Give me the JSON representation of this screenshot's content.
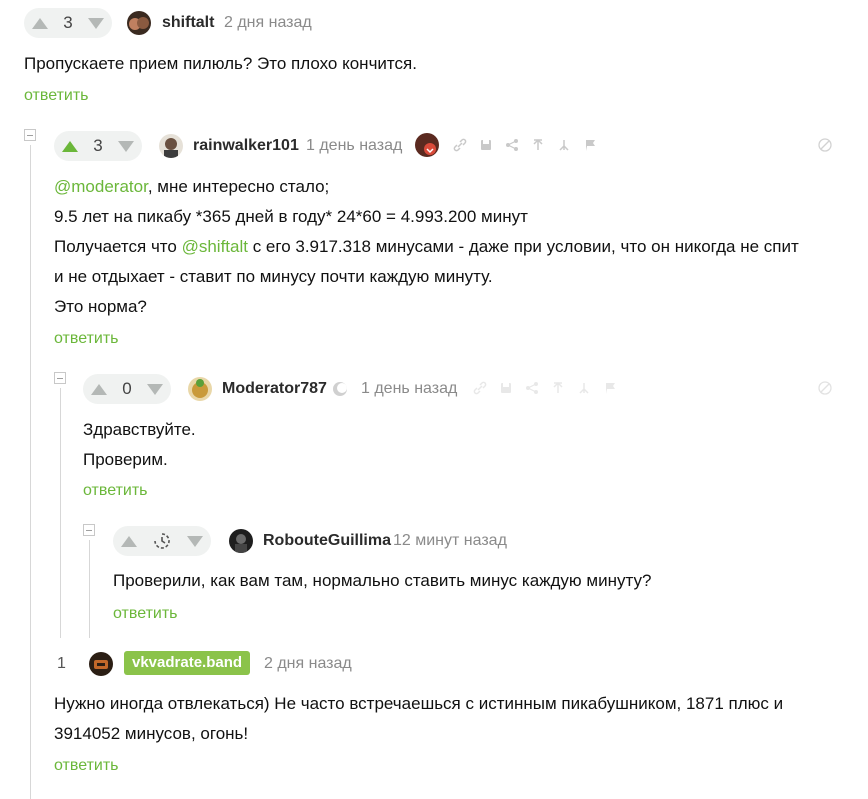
{
  "comments": [
    {
      "rating": "3",
      "username": "shiftalt",
      "time": "2 дня назад",
      "lines": [
        "Пропускаете прием пилюль? Это плохо кончится."
      ],
      "reply": "ответить"
    },
    {
      "rating": "3",
      "username": "rainwalker101",
      "time": "1 день назад",
      "line1_mention": "@moderator",
      "line1_rest": ", мне интересно стало;",
      "line2": "9.5 лет на пикабу *365 дней в году* 24*60 = 4.993.200 минут",
      "line3_pre": "Получается что ",
      "line3_mention": "@shiftalt",
      "line3_rest": " с его 3.917.318 минусами - даже при условии, что он никогда не спит",
      "line4": "и не отдыхает - ставит по минусу почти каждую минуту.",
      "line5": "Это норма?",
      "reply": "ответить"
    },
    {
      "rating": "0",
      "username": "Moderator787",
      "time": "1 день назад",
      "lines": [
        "Здравствуйте.",
        "Проверим."
      ],
      "reply": "ответить"
    },
    {
      "username": "RobouteGuillima",
      "time": "12 минут назад",
      "lines": [
        "Проверили, как вам там, нормально ставить минус каждую минуту?"
      ],
      "reply": "ответить"
    },
    {
      "count": "1",
      "username": "vkvadrate.band",
      "time": "2 дня назад",
      "lines": [
        "Нужно иногда отвлекаться) Не часто встречаешься с истинным пикабушником, 1871 плюс и",
        "3914052 минусов, огонь!"
      ],
      "reply": "ответить"
    }
  ],
  "colors": {
    "accent": "#6bb73a",
    "band": "#8bc34a"
  },
  "icons": [
    "link-icon",
    "save-icon",
    "share-icon",
    "upload-icon",
    "branch-icon",
    "flag-icon",
    "block-icon",
    "pending-icon"
  ]
}
